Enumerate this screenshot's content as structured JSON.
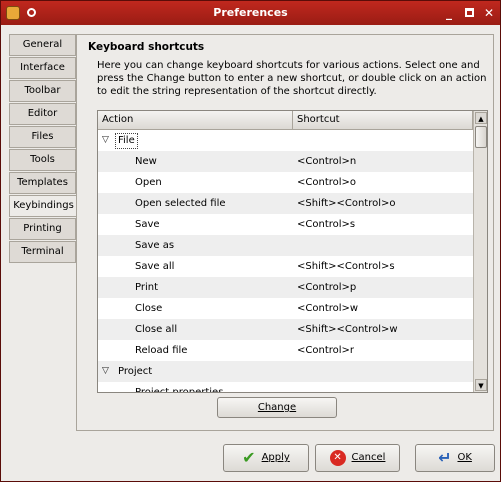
{
  "window": {
    "title": "Preferences"
  },
  "tabs": [
    {
      "label": "General"
    },
    {
      "label": "Interface"
    },
    {
      "label": "Toolbar"
    },
    {
      "label": "Editor"
    },
    {
      "label": "Files"
    },
    {
      "label": "Tools"
    },
    {
      "label": "Templates"
    },
    {
      "label": "Keybindings"
    },
    {
      "label": "Printing"
    },
    {
      "label": "Terminal"
    }
  ],
  "active_tab": "Keybindings",
  "section": {
    "title": "Keyboard shortcuts",
    "description": "Here you can change keyboard shortcuts for various actions. Select one and press the Change button to enter a new shortcut, or double click on an action to edit the string representation of the shortcut directly."
  },
  "table": {
    "columns": [
      "Action",
      "Shortcut"
    ],
    "rows": [
      {
        "type": "group",
        "action": "File",
        "shortcut": "",
        "expanded": true
      },
      {
        "type": "item",
        "action": "New",
        "shortcut": "<Control>n"
      },
      {
        "type": "item",
        "action": "Open",
        "shortcut": "<Control>o"
      },
      {
        "type": "item",
        "action": "Open selected file",
        "shortcut": "<Shift><Control>o"
      },
      {
        "type": "item",
        "action": "Save",
        "shortcut": "<Control>s"
      },
      {
        "type": "item",
        "action": "Save as",
        "shortcut": ""
      },
      {
        "type": "item",
        "action": "Save all",
        "shortcut": "<Shift><Control>s"
      },
      {
        "type": "item",
        "action": "Print",
        "shortcut": "<Control>p"
      },
      {
        "type": "item",
        "action": "Close",
        "shortcut": "<Control>w"
      },
      {
        "type": "item",
        "action": "Close all",
        "shortcut": "<Shift><Control>w"
      },
      {
        "type": "item",
        "action": "Reload file",
        "shortcut": "<Control>r"
      },
      {
        "type": "group",
        "action": "Project",
        "shortcut": "",
        "expanded": true
      },
      {
        "type": "item",
        "action": "Project properties",
        "shortcut": ""
      }
    ]
  },
  "buttons": {
    "change": "Change",
    "apply": "Apply",
    "cancel": "Cancel",
    "ok": "OK"
  },
  "icons": {
    "apply": "check-icon",
    "cancel": "cancel-icon",
    "ok": "ok-arrow-icon"
  },
  "colors": {
    "titlebar": "#b02218",
    "window_bg": "#edebe8"
  }
}
